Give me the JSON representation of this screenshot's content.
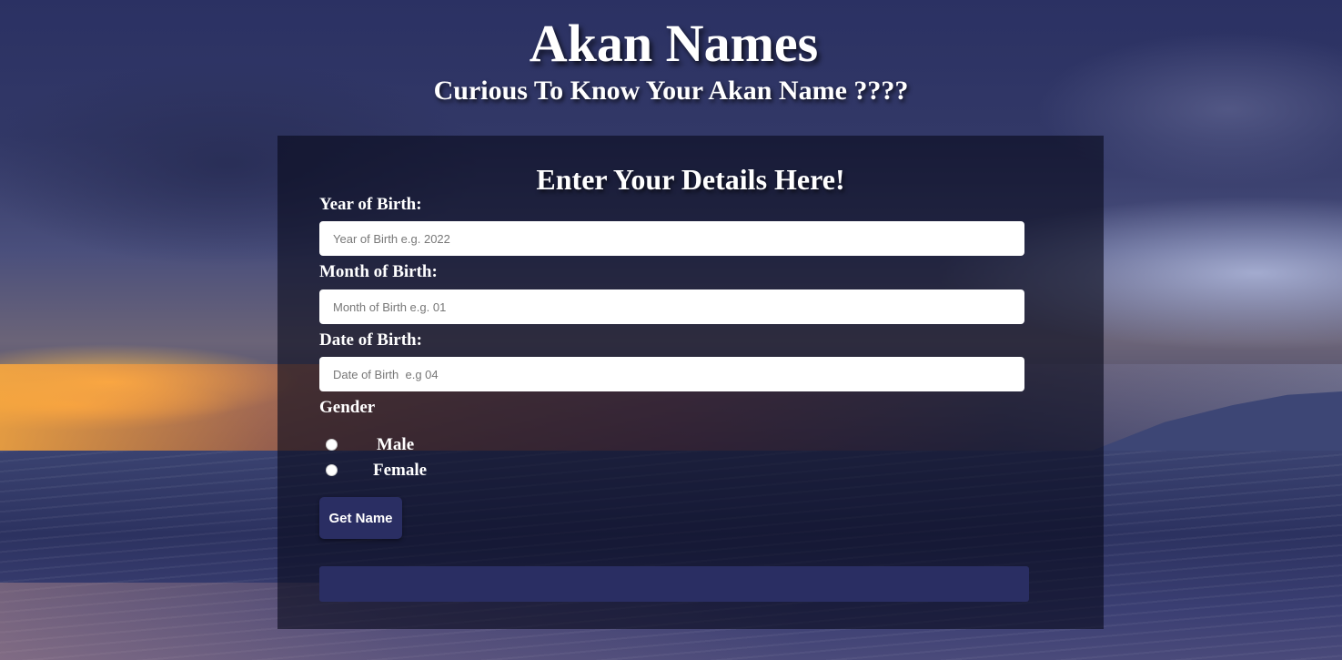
{
  "header": {
    "title": "Akan Names",
    "subtitle": "Curious To Know Your Akan Name ????"
  },
  "form": {
    "heading": "Enter Your Details Here!",
    "year": {
      "label": "Year of Birth:",
      "placeholder": "Year of Birth e.g. 2022",
      "value": ""
    },
    "month": {
      "label": "Month of Birth:",
      "placeholder": "Month of Birth e.g. 01",
      "value": ""
    },
    "date": {
      "label": "Date of Birth:",
      "placeholder": "Date of Birth  e.g 04",
      "value": ""
    },
    "gender": {
      "label": "Gender",
      "options": [
        {
          "label": "Male",
          "selected": false
        },
        {
          "label": "Female",
          "selected": false
        }
      ]
    },
    "submit_label": "Get Name",
    "result": ""
  },
  "colors": {
    "button_bg": "#2a2e63",
    "card_bg": "rgba(8,10,28,0.62)",
    "text": "#ffffff"
  }
}
